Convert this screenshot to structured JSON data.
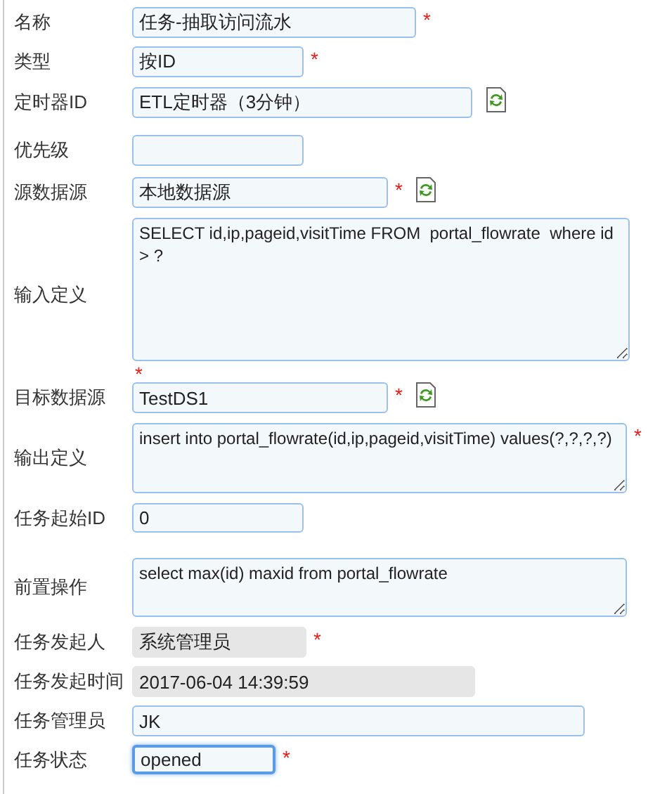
{
  "fields": [
    {
      "label": "名称",
      "kind": "input",
      "value": "任务-抽取访问流水",
      "required_mark": "*",
      "refresh": false,
      "focused": false
    },
    {
      "label": "类型",
      "kind": "input",
      "value": "按ID",
      "required_mark": "*",
      "refresh": false,
      "focused": false
    },
    {
      "label": "定时器ID",
      "kind": "input",
      "value": "ETL定时器（3分钟）",
      "refresh": true,
      "focused": false
    },
    {
      "label": "优先级",
      "kind": "input",
      "refresh": false,
      "focused": false
    },
    {
      "label": "源数据源",
      "kind": "input",
      "value": "本地数据源",
      "required_mark": "*",
      "refresh": true,
      "focused": false
    },
    {
      "label": "输入定义",
      "kind": "textarea",
      "value": "SELECT id,ip,pageid,visitTime FROM  portal_flowrate  where id > ?",
      "required_mark": "*",
      "required_mark_below": true,
      "refresh": false,
      "focused": false
    },
    {
      "label": "目标数据源",
      "kind": "input",
      "value": "TestDS1",
      "required_mark": "*",
      "refresh": true,
      "focused": false
    },
    {
      "label": "输出定义",
      "kind": "textarea",
      "value": "insert into portal_flowrate(id,ip,pageid,visitTime) values(?,?,?,?)",
      "required_mark": "*",
      "required_mark_below": false,
      "refresh": false,
      "focused": false
    },
    {
      "label": "任务起始ID",
      "kind": "input",
      "value": "0",
      "refresh": false,
      "focused": false
    },
    {
      "label": "前置操作",
      "kind": "textarea",
      "value": "select max(id) maxid from portal_flowrate",
      "refresh": false,
      "focused": false
    },
    {
      "label": "任务发起人",
      "kind": "readonly",
      "value": "系统管理员",
      "required_mark": "*",
      "refresh": false,
      "focused": false
    },
    {
      "label": "任务发起时间",
      "kind": "readonly",
      "value": "2017-06-04 14:39:59",
      "refresh": false,
      "focused": false
    },
    {
      "label": "任务管理员",
      "kind": "input",
      "value": "JK",
      "refresh": false,
      "focused": false
    },
    {
      "label": "任务状态",
      "kind": "input",
      "value": "opened",
      "required_mark": "*",
      "refresh": false,
      "focused": true
    }
  ]
}
